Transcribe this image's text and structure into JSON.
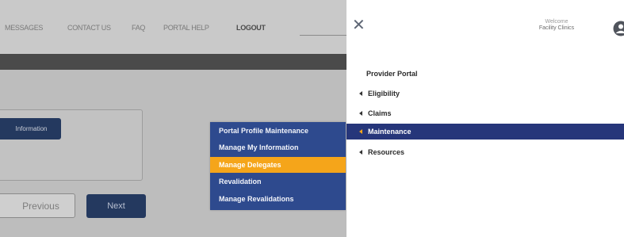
{
  "top_nav": {
    "items": [
      "MESSAGES",
      "CONTACT US",
      "FAQ",
      "PORTAL HELP"
    ],
    "logout": "LOGOUT"
  },
  "content": {
    "info_button": "Information",
    "previous_button": "Previous",
    "next_button": "Next"
  },
  "submenu": {
    "items": [
      "Portal Profile Maintenance",
      "Manage My Information",
      "Manage Delegates",
      "Revalidation",
      "Manage Revalidations"
    ],
    "active_index": 2
  },
  "panel": {
    "close_icon": "close-icon",
    "welcome_label": "Welcome",
    "welcome_name": "Facility Clinics",
    "user_icon": "user-icon",
    "title": "Provider Portal",
    "menu": [
      "Eligibility",
      "Claims",
      "Maintenance",
      "Resources"
    ],
    "active_menu": "Maintenance"
  },
  "colors": {
    "navy": "#26367a",
    "submenu_blue": "#2e4a8e",
    "orange": "#f5a51a",
    "overlay_gray": "#bdbdbd"
  }
}
